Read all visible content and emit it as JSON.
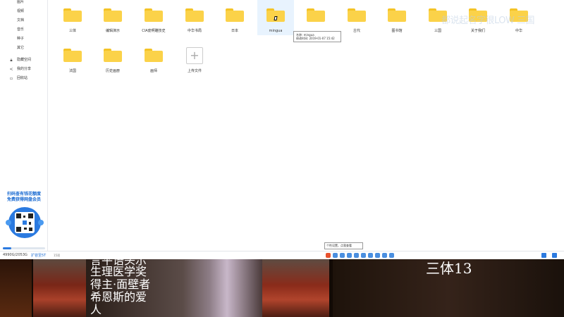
{
  "sidebar": {
    "nav": [
      "图片",
      "视频",
      "文档",
      "音乐",
      "种子",
      "其它"
    ],
    "extra": [
      {
        "label": "隐藏空间",
        "icon": "lock-icon"
      },
      {
        "label": "我的分享",
        "icon": "share-icon"
      },
      {
        "label": "回收站",
        "icon": "trash-icon"
      }
    ],
    "promo": [
      "扫码查有钱花额度",
      "免费获得网盘会员"
    ],
    "storage_used_fraction": 0.2
  },
  "folders": [
    {
      "name": "三体"
    },
    {
      "name": "编辑演示"
    },
    {
      "name": "CIA庞啊雕技史"
    },
    {
      "name": "中华书局"
    },
    {
      "name": "日本"
    },
    {
      "name": "mingua"
    },
    {
      "name": ""
    },
    {
      "name": "古代"
    },
    {
      "name": "图书馆"
    },
    {
      "name": "三国"
    },
    {
      "name": "关于我们"
    },
    {
      "name": "中华"
    },
    {
      "name": "法国"
    },
    {
      "name": "历史画册"
    },
    {
      "name": "画师"
    }
  ],
  "upload": {
    "label": "上传文件",
    "icon": "plus-icon"
  },
  "tooltip": {
    "name": "名称: mingua",
    "modified": "修改时间: 2019-01-07 15:42"
  },
  "watermark": "都说起名字很LOW 三国",
  "statusbar": {
    "storage": "4990G/2053G",
    "expand": "扩容至5T",
    "count": "15项"
  },
  "tray_tip": "个性设置，点我查看",
  "video": {
    "subtitle_cut": "言平语头示",
    "subtitle_lines": [
      "生理医学奖",
      "得主·面壁者",
      "希恩斯的爱",
      "人"
    ],
    "right_title": "三体13"
  },
  "colors": {
    "folder": "#fbd249",
    "accent": "#2b7ae0"
  }
}
